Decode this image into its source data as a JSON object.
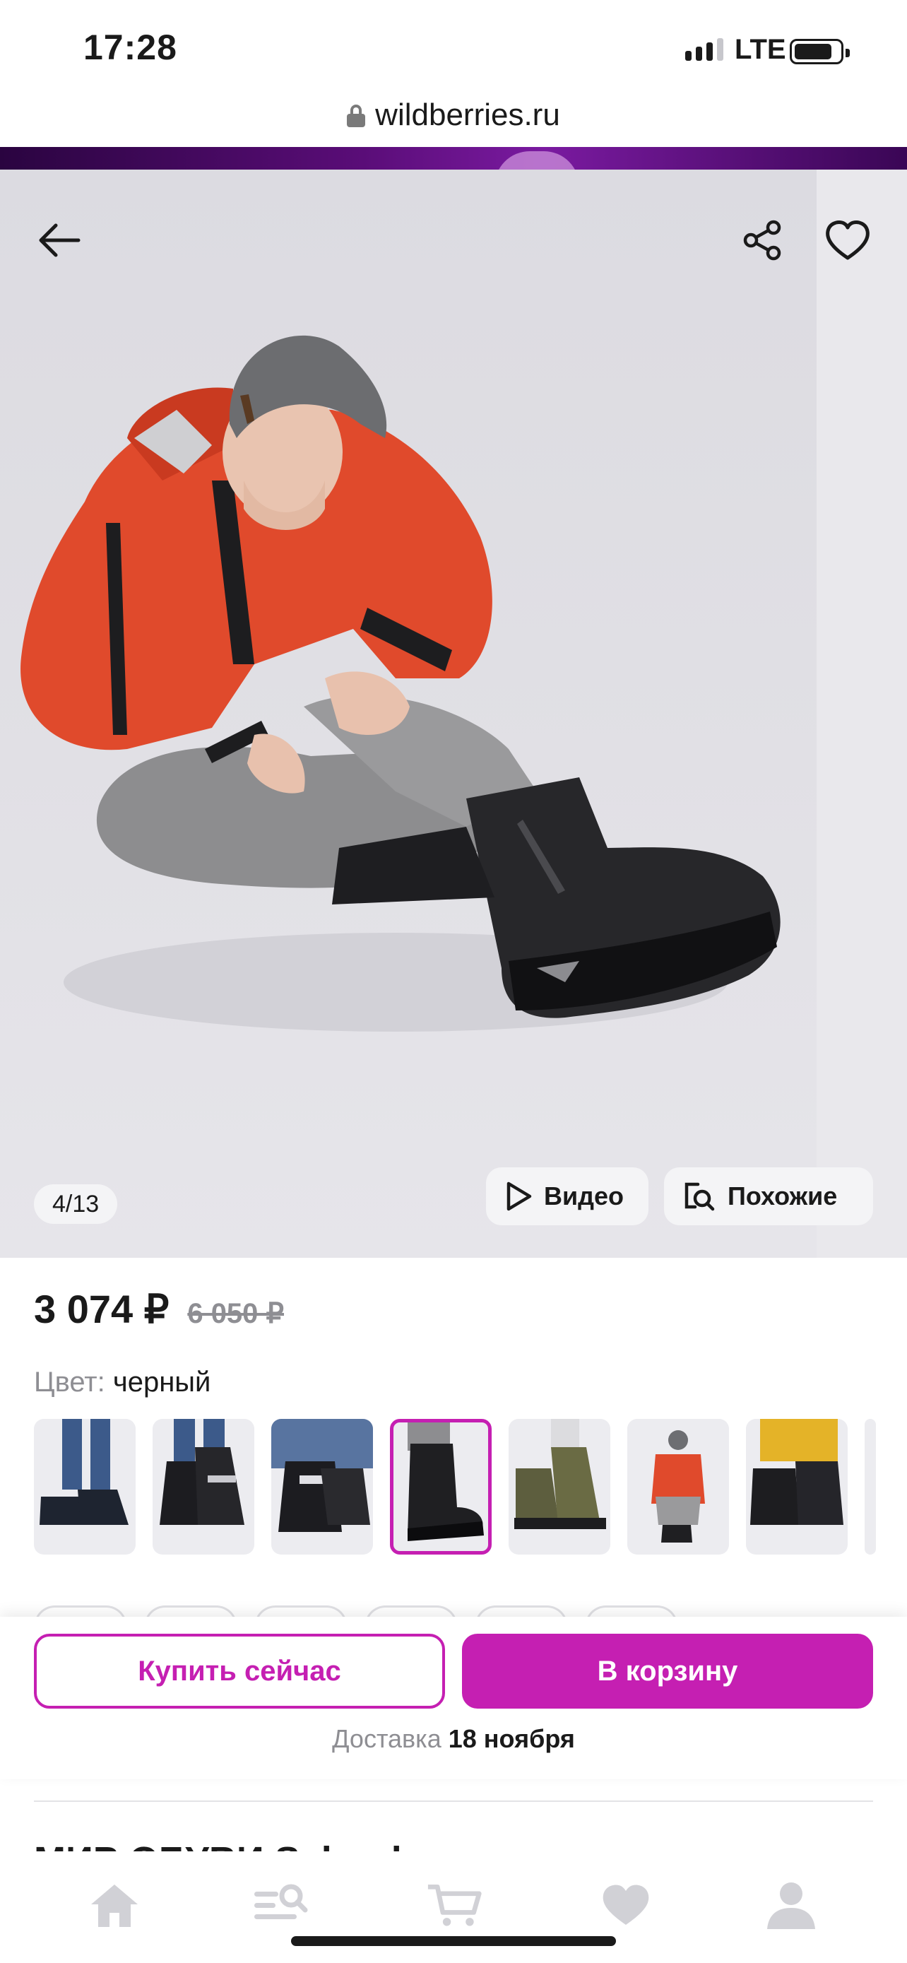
{
  "status_bar": {
    "time": "17:28",
    "network": "LTE"
  },
  "browser": {
    "url": "wildberries.ru"
  },
  "gallery": {
    "counter": "4/13",
    "video_label": "Видео",
    "similar_label": "Похожие"
  },
  "product": {
    "price": "3 074 ₽",
    "old_price": "6 050 ₽",
    "color_label": "Цвет:",
    "color_value": "черный",
    "thumbnails_count": 8,
    "selected_thumbnail": 4
  },
  "actions": {
    "buy_now": "Купить сейчас",
    "add_to_cart": "В корзину",
    "delivery_label": "Доставка",
    "delivery_date": "18 ноября"
  },
  "seller": {
    "name": "МИР ОБУВИ School"
  },
  "colors": {
    "accent": "#c51fb2",
    "muted": "#8e8e93"
  },
  "tab_bar": {
    "items": [
      "home-icon",
      "catalog-search-icon",
      "cart-icon",
      "favorites-icon",
      "profile-icon"
    ]
  }
}
